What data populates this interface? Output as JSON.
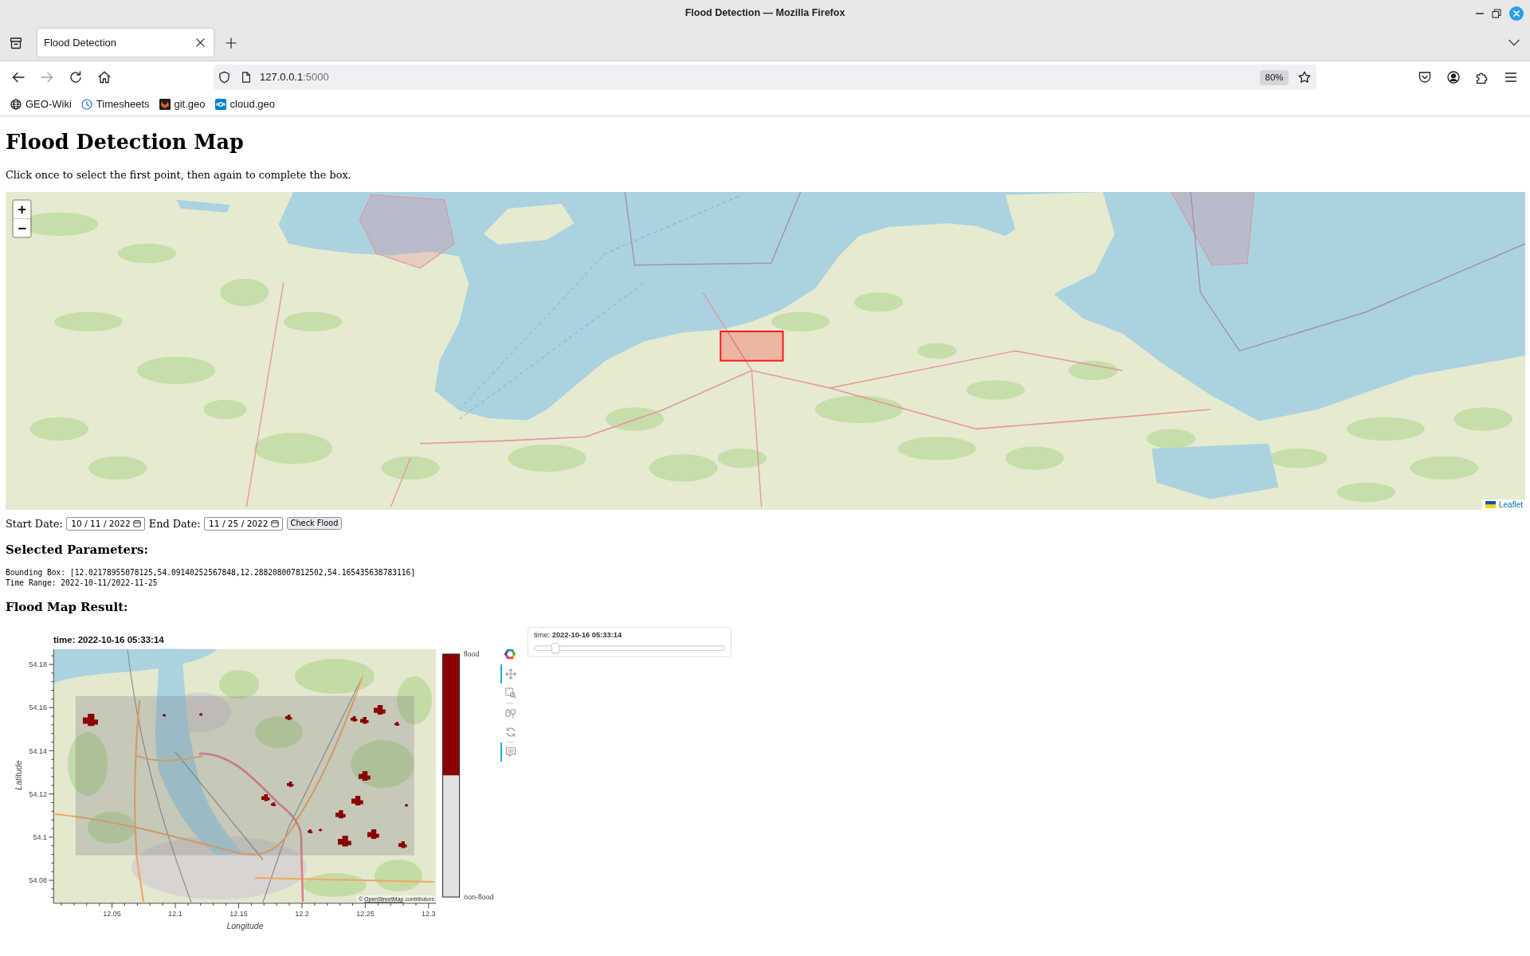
{
  "window": {
    "title": "Flood Detection — Mozilla Firefox"
  },
  "tabs": [
    {
      "label": "Flood Detection",
      "selected": true
    }
  ],
  "navigation": [
    {
      "kind": "back",
      "disabled": false
    },
    {
      "kind": "forward",
      "disabled": true
    },
    {
      "kind": "reload",
      "disabled": false
    },
    {
      "kind": "home",
      "disabled": false
    }
  ],
  "address_bar": {
    "host": "127.0.0.1",
    "port": ":5000",
    "zoom": "80%"
  },
  "bookmarks": [
    {
      "kind": "globe",
      "label": "GEO-Wiki"
    },
    {
      "kind": "clock",
      "label": "Timesheets"
    },
    {
      "kind": "fox",
      "label": "git.geo"
    },
    {
      "kind": "cloud",
      "label": "cloud.geo"
    }
  ],
  "page": {
    "heading": "Flood Detection Map",
    "instructions": "Click once to select the first point, then again to complete the box."
  },
  "map": {
    "zoom_in": "+",
    "zoom_out": "−",
    "selection_box": true,
    "attribution": "Leaflet"
  },
  "form": {
    "fields": [
      {
        "label": "Start Date:",
        "value": "10 / 11 / 2022"
      },
      {
        "label": "End Date:",
        "value": "11 / 25 / 2022"
      }
    ],
    "button": "Check Flood"
  },
  "parameters": {
    "heading": "Selected Parameters:",
    "lines": [
      "Bounding Box: [12.02178955078125,54.09140252567848,12.288208007812502,54.165435638783116]",
      "Time Range: 2022-10-11/2022-11-25"
    ]
  },
  "result": {
    "heading": "Flood Map Result:",
    "plot": {
      "title": "time: 2022-10-16 05:33:14",
      "x_axis": {
        "label": "Longitude",
        "ticks": [
          "12.05",
          "12.1",
          "12.15",
          "12.2",
          "12.25",
          "12.3"
        ]
      },
      "y_axis": {
        "label": "Latitude",
        "ticks": [
          "54.18",
          "54.16",
          "54.14",
          "54.12",
          "54.1",
          "54.08"
        ]
      },
      "attribution": {
        "prefix": "©",
        "link": "OpenStreetMap",
        "suffix": "contributors"
      },
      "legend": [
        {
          "label": "flood",
          "color": "#8b0000"
        },
        {
          "label": "non-flood",
          "color": "#e1e1e1"
        }
      ]
    },
    "toolbar": [
      {
        "kind": "pan",
        "active": true
      },
      {
        "kind": "box_zoom",
        "active": false
      },
      {
        "kind": "wheel_zoom",
        "active": false
      },
      {
        "kind": "reset",
        "active": false
      },
      {
        "kind": "hover",
        "active": true
      }
    ],
    "slider": {
      "caption": "time: **2022-10-16 05:33:14**",
      "level": 0.11
    }
  }
}
